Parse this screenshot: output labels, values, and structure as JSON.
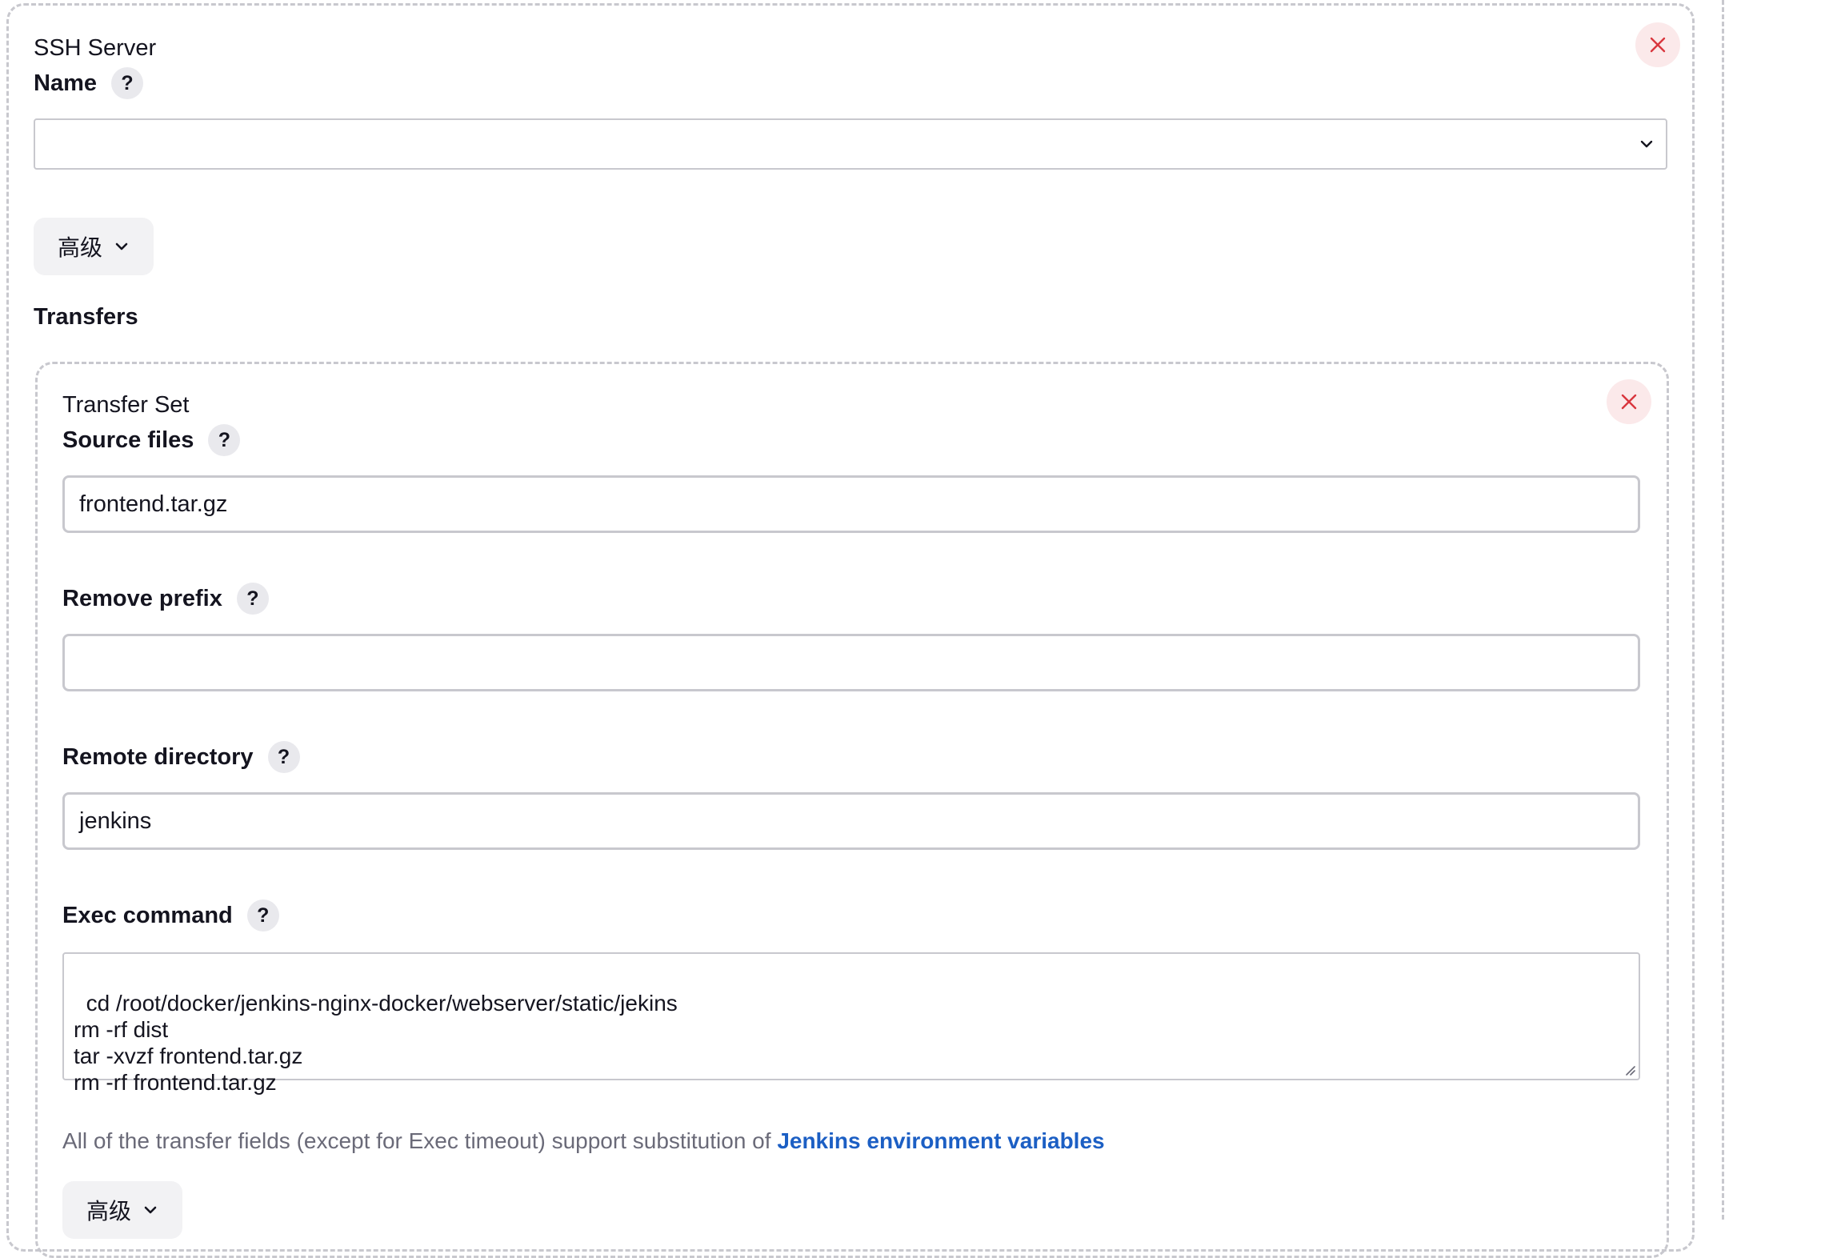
{
  "ssh_server": {
    "title": "SSH Server",
    "name_label": "Name",
    "name_value": "",
    "advanced_label": "高级",
    "transfers_label": "Transfers"
  },
  "transfer_set": {
    "title": "Transfer Set",
    "source_files": {
      "label": "Source files",
      "value": "frontend.tar.gz"
    },
    "remove_prefix": {
      "label": "Remove prefix",
      "value": ""
    },
    "remote_directory": {
      "label": "Remote directory",
      "value": "jenkins"
    },
    "exec_command": {
      "label": "Exec command",
      "value": "cd /root/docker/jenkins-nginx-docker/webserver/static/jekins\nrm -rf dist\ntar -xvzf frontend.tar.gz\nrm -rf frontend.tar.gz"
    },
    "hint_text": "All of the transfer fields (except for Exec timeout) support substitution of ",
    "hint_link": "Jenkins environment variables",
    "advanced_label": "高级"
  },
  "icons": {
    "help": "?",
    "close": "close-icon",
    "chevron": "chevron-down-icon"
  },
  "colors": {
    "close_icon": "#d9363e",
    "close_bg": "#fbe9ea",
    "link": "#1c5fc4",
    "border": "#c8c8ce"
  }
}
